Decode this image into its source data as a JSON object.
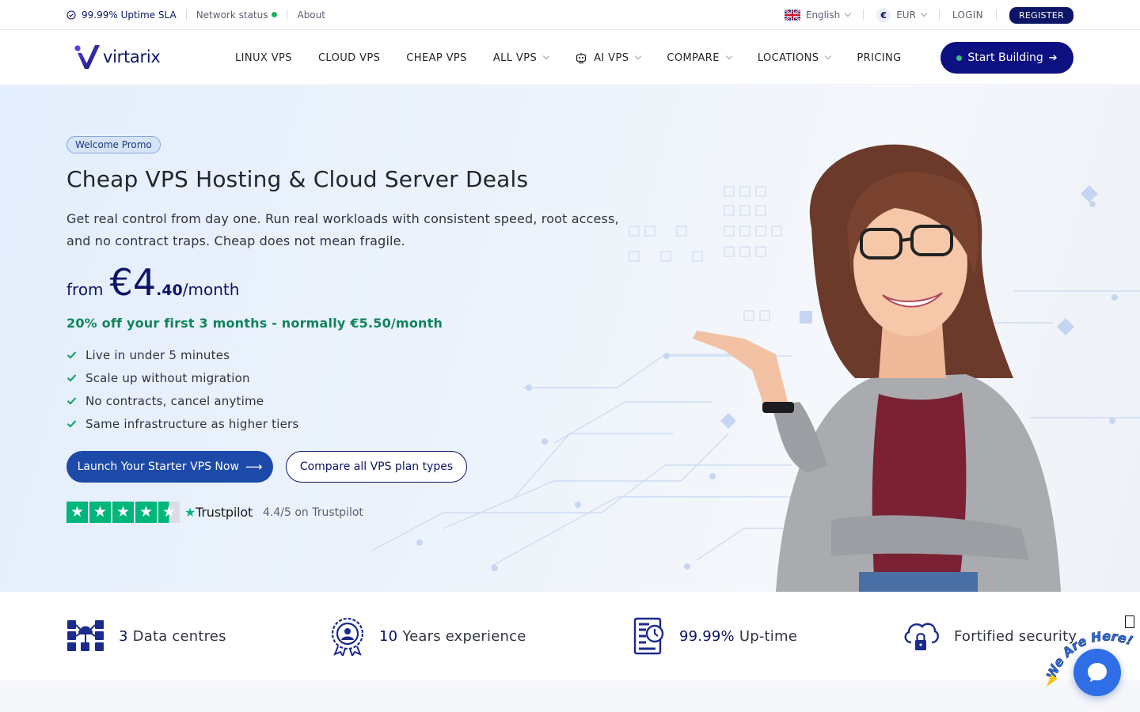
{
  "topbar": {
    "uptime_sla": "99.99% Uptime SLA",
    "network_status": "Network status",
    "about": "About",
    "language": "English",
    "currency_symbol": "€",
    "currency": "EUR",
    "login": "LOGIN",
    "register": "REGISTER"
  },
  "nav": {
    "logo_text": "virtarix",
    "items": [
      {
        "label": "LINUX VPS"
      },
      {
        "label": "CLOUD VPS"
      },
      {
        "label": "CHEAP VPS"
      },
      {
        "label": "ALL VPS"
      },
      {
        "label": "AI VPS"
      },
      {
        "label": "COMPARE"
      },
      {
        "label": "LOCATIONS"
      },
      {
        "label": "PRICING"
      }
    ],
    "cta": "Start Building"
  },
  "hero": {
    "badge": "Welcome Promo",
    "title": "Cheap VPS Hosting & Cloud Server Deals",
    "lead": "Get real control from day one. Run real workloads with consistent speed, root access, and no contract traps. Cheap does not mean fragile.",
    "price": {
      "from": "from",
      "whole": "€4",
      "cents": ".40",
      "period": "/month"
    },
    "promo": "20% off your first 3 months - normally €5.50/month",
    "features": [
      "Live in under 5 minutes",
      "Scale up without migration",
      "No contracts, cancel anytime",
      "Same infrastructure as higher tiers"
    ],
    "primary_cta": "Launch Your Starter VPS Now",
    "secondary_cta": "Compare all VPS plan types",
    "trustpilot": {
      "brand": "Trustpilot",
      "rating_text": "4.4/5 on Trustpilot",
      "stars": 4.5
    }
  },
  "stats": [
    {
      "highlight": "3",
      "text": "Data centres",
      "icon": "data-centres-icon"
    },
    {
      "highlight": "10",
      "text": "Years experience",
      "icon": "experience-badge-icon"
    },
    {
      "highlight": "99.99%",
      "text": "Up-time",
      "icon": "server-uptime-icon"
    },
    {
      "highlight": "",
      "text": "Fortified security",
      "icon": "cloud-lock-icon"
    }
  ],
  "chat": {
    "tagline": "We Are Here!"
  },
  "colors": {
    "brand_navy": "#0d1566",
    "primary_button": "#1d4aa8",
    "promo_green": "#10845a",
    "check_green": "#1aa06a",
    "trustpilot_green": "#00b67a",
    "chat_blue": "#2f6ee6"
  }
}
